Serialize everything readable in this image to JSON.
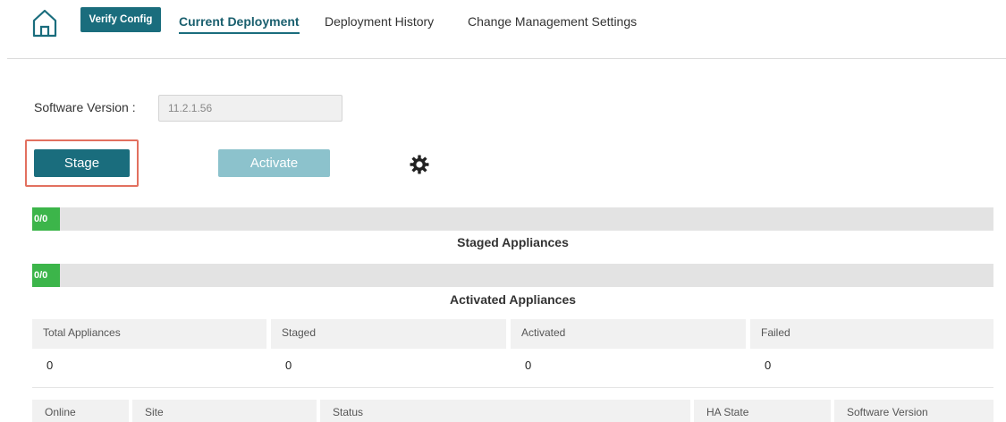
{
  "nav": {
    "verify_config": "Verify Config",
    "tabs": [
      {
        "label": "Current Deployment",
        "active": true
      },
      {
        "label": "Deployment History",
        "active": false
      },
      {
        "label": "Change Management Settings",
        "active": false
      }
    ]
  },
  "form": {
    "software_version_label": "Software Version :",
    "software_version_value": "11.2.1.56"
  },
  "actions": {
    "stage": "Stage",
    "activate": "Activate",
    "settings_icon": "gear-icon"
  },
  "progress": {
    "staged": {
      "text": "0/0",
      "fraction": 0,
      "title": "Staged Appliances"
    },
    "activated": {
      "text": "0/0",
      "fraction": 0,
      "title": "Activated Appliances"
    }
  },
  "summary": {
    "headers": [
      "Total Appliances",
      "Staged",
      "Activated",
      "Failed"
    ],
    "values": [
      "0",
      "0",
      "0",
      "0"
    ]
  },
  "appliance_table": {
    "headers": [
      "Online",
      "Site",
      "Status",
      "HA State",
      "Software Version"
    ]
  },
  "colors": {
    "primary": "#1a6d7d",
    "primary_disabled": "#8cc2cc",
    "progress_fill": "#3cb54a",
    "highlight": "#e2705f"
  }
}
